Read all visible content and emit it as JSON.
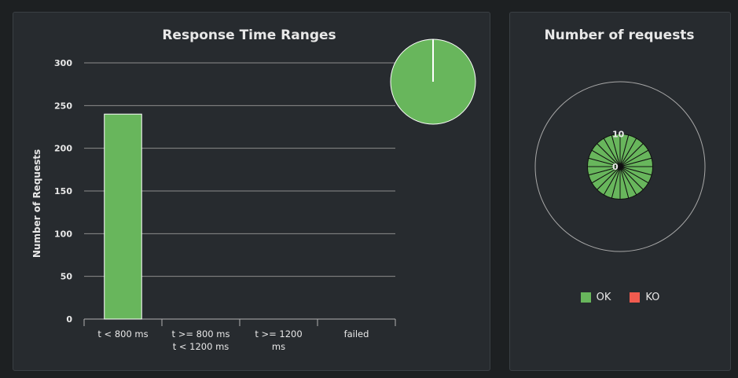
{
  "colors": {
    "ok": "#68b65c",
    "ko": "#f15b4f",
    "grid": "#8c8c8c",
    "text": "#e8e8e8"
  },
  "chart_data": [
    {
      "type": "bar",
      "title": "Response Time Ranges",
      "ylabel": "Number of Requests",
      "xlabel": "",
      "ylim": [
        0,
        300
      ],
      "yticks": [
        0,
        50,
        100,
        150,
        200,
        250,
        300
      ],
      "grid": true,
      "categories": [
        [
          "t < 800 ms"
        ],
        [
          "t >= 800 ms",
          "t < 1200 ms"
        ],
        [
          "t >= 1200",
          "ms"
        ],
        [
          "failed"
        ]
      ],
      "values": [
        240,
        0,
        0,
        0
      ],
      "inset_pie": {
        "type": "pie",
        "slices": [
          {
            "label": "t < 800 ms",
            "value": 240
          },
          {
            "label": "t >= 800 ms t < 1200 ms",
            "value": 0
          },
          {
            "label": "t >= 1200 ms",
            "value": 0
          },
          {
            "label": "failed",
            "value": 0
          }
        ]
      }
    },
    {
      "type": "polar-stacked-column",
      "title": "Number of requests",
      "radial_ticks": [
        0,
        10
      ],
      "radial_max": 26,
      "series": [
        {
          "name": "OK",
          "values": [
            10,
            10,
            10,
            10,
            10,
            10,
            10,
            10,
            10,
            10,
            10,
            10,
            10,
            10,
            10,
            10,
            10,
            10,
            10,
            10,
            10,
            10,
            10,
            10
          ]
        },
        {
          "name": "KO",
          "values": [
            0,
            0,
            0,
            0,
            0,
            0,
            0,
            0,
            0,
            0,
            0,
            0,
            0,
            0,
            0,
            0,
            0,
            0,
            0,
            0,
            0,
            0,
            0,
            0
          ]
        }
      ],
      "legend": [
        "OK",
        "KO"
      ],
      "legend_position": "bottom"
    }
  ]
}
